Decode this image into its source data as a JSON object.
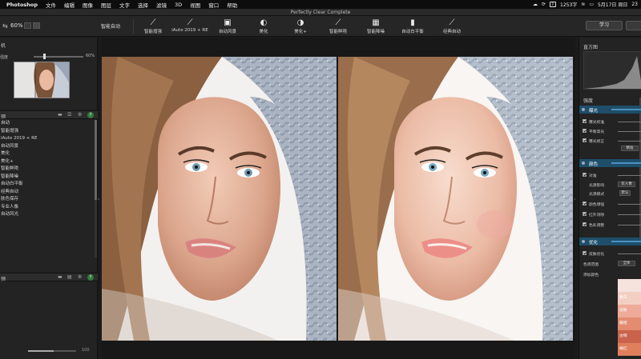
{
  "menubar": {
    "app": "Photoshop",
    "items": [
      "文件",
      "编辑",
      "图像",
      "图层",
      "文字",
      "选择",
      "滤镜",
      "3D",
      "视图",
      "窗口",
      "帮助"
    ],
    "status": {
      "memory": "1253字",
      "date": "5月17日 周日",
      "time": "23"
    }
  },
  "titlebar": {
    "title": "Perfectly Clear Complete"
  },
  "toolbar": {
    "zoom": "60%",
    "preset_select": "智能自动",
    "tools": [
      {
        "label": "智能增强",
        "icon": "wand-icon"
      },
      {
        "label": "iAuto 2019 + RE",
        "icon": "wand-icon"
      },
      {
        "label": "自动风景",
        "icon": "landscape-icon"
      },
      {
        "label": "美化",
        "icon": "face-icon"
      },
      {
        "label": "美化+",
        "icon": "face-plus-icon"
      },
      {
        "label": "智能鲜艳",
        "icon": "brush-icon"
      },
      {
        "label": "智能降噪",
        "icon": "noise-icon"
      },
      {
        "label": "自动白平衡",
        "icon": "thermometer-icon"
      },
      {
        "label": "经典自动",
        "icon": "wand-hd-icon"
      }
    ],
    "learn_button": "学习"
  },
  "left": {
    "panel_title": "机",
    "strength_label": "强度",
    "strength_value": "60%",
    "strength": 0.6,
    "presets_title": "预",
    "presets": [
      "自动",
      "智能增强",
      "iAuto 2019 + RE",
      "自动风景",
      "美化",
      "美化+",
      "智能鲜艳",
      "智能降噪",
      "自动白平衡",
      "经典自动",
      "肤色保存",
      "专业人像",
      "自动风光"
    ],
    "custom_title": "预",
    "bottom_value": "100"
  },
  "right": {
    "histogram_title": "直方图",
    "strength_title": "强度",
    "sections": {
      "exposure": "曝光",
      "color": "颜色",
      "beautify": "优化"
    },
    "exposure_rows": [
      "曝光校准",
      "平衡高光",
      "曝光修正"
    ],
    "exposure_pill": "精准",
    "color_rows": [
      "对准",
      "光源影响",
      "光源模式",
      "颜色增强",
      "红外消除",
      "色彩调整"
    ],
    "color_pills": [
      "仅人像",
      "默认"
    ],
    "beautify_rows": [
      "皮肤优化",
      "色调范围",
      "添加颜色"
    ],
    "beautify_pill": "全体",
    "swatches": [
      {
        "label": "",
        "color": "#f6e2dd"
      },
      {
        "label": "象白",
        "color": "#f3cfc3"
      },
      {
        "label": "淡肤",
        "color": "#eeab9a"
      },
      {
        "label": "暖橙",
        "color": "#e48b72"
      },
      {
        "label": "古铜",
        "color": "#c9634c"
      },
      {
        "label": "橘红",
        "color": "#df7f5c"
      }
    ]
  },
  "colors": {
    "accent_blue": "#1e4e6a",
    "help_green": "#2f7a3a",
    "panel_bg": "#232323"
  }
}
